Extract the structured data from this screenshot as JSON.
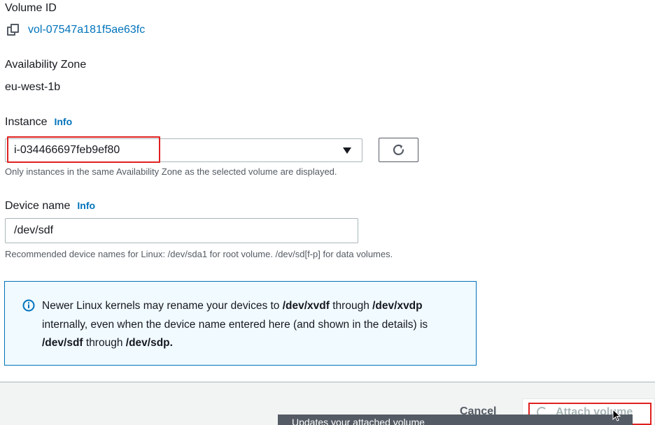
{
  "volume": {
    "label": "Volume ID",
    "id": "vol-07547a181f5ae63fc",
    "icon": "copy-icon"
  },
  "az": {
    "label": "Availability Zone",
    "value": "eu-west-1b"
  },
  "instance": {
    "label": "Instance",
    "info": "Info",
    "selected": "i-034466697feb9ef80",
    "hint": "Only instances in the same Availability Zone as the selected volume are displayed.",
    "refresh_icon": "refresh-icon"
  },
  "device": {
    "label": "Device name",
    "info": "Info",
    "value": "/dev/sdf",
    "hint": "Recommended device names for Linux: /dev/sda1 for root volume. /dev/sd[f-p] for data volumes."
  },
  "alert": {
    "icon": "info-circle-icon",
    "t1": "Newer Linux kernels may rename your devices to ",
    "b1": "/dev/xvdf",
    "t2": " through ",
    "b2": "/dev/xvdp",
    "t3": " internally, even when the device name entered here (and shown in the details) is ",
    "b3": "/dev/sdf",
    "t4": " through ",
    "b4": "/dev/sdp."
  },
  "footer": {
    "cancel": "Cancel",
    "attach": "Attach volume"
  },
  "tooltip": {
    "text": "Updates your attached volume"
  },
  "colors": {
    "link": "#0073bb",
    "highlight": "#e02020",
    "alert_bg": "#f1faff",
    "alert_border": "#0073bb"
  }
}
